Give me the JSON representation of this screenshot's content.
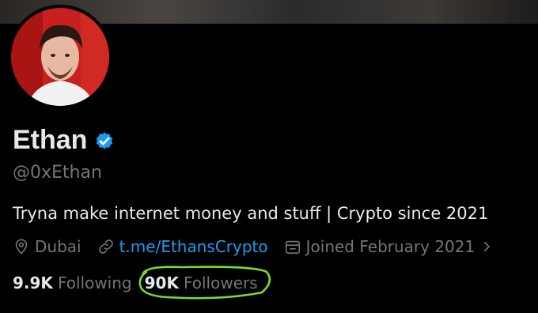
{
  "profile": {
    "display_name": "Ethan",
    "handle": "@0xEthan",
    "bio": "Tryna make internet money and stuff | Crypto since 2021",
    "location": "Dubai",
    "link": "t.me/EthansCrypto",
    "joined": "Joined February 2021"
  },
  "stats": {
    "following_count": "9.9K",
    "following_label": "Following",
    "followers_count": "90K",
    "followers_label": "Followers"
  },
  "icons": {
    "verified": "verified-badge-icon",
    "location": "location-pin-icon",
    "link": "link-icon",
    "calendar": "calendar-icon",
    "chevron": "chevron-right-icon"
  },
  "colors": {
    "background": "#000000",
    "accent": "#1d9bf0",
    "secondary_text": "#71767b",
    "annotation": "#7ddc2a"
  }
}
